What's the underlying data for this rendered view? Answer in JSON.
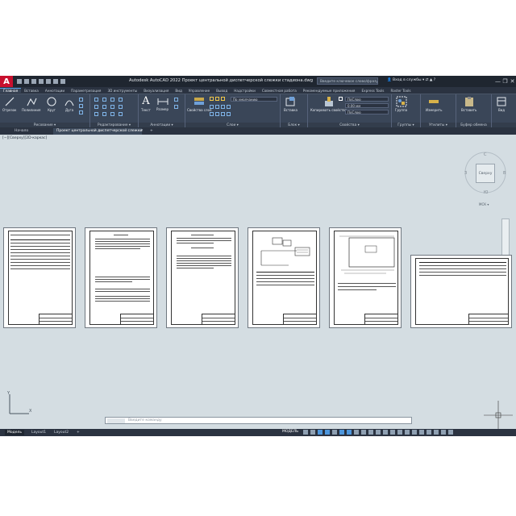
{
  "app": {
    "logo": "A",
    "title": "Autodesk AutoCAD 2022   Проект центральной диспетчерской слежки стадиона.dwg",
    "search_placeholder": "Введите ключевое слово/фразу",
    "login": "Вход в службы",
    "window_buttons": [
      "—",
      "❐",
      "✕"
    ]
  },
  "ribbon_tabs": [
    "Главная",
    "Вставка",
    "Аннотации",
    "Параметризация",
    "3D инструменты",
    "Визуализация",
    "Вид",
    "Управление",
    "Вывод",
    "Надстройки",
    "Совместная работа",
    "Рекомендуемые приложения",
    "Express Tools",
    "Raster Tools"
  ],
  "ribbon": {
    "panels": [
      {
        "label": "Рисование ▾",
        "tools": [
          "Отрезок",
          "Полилиния",
          "Круг",
          "Дуга"
        ]
      },
      {
        "label": "Редактирование ▾",
        "tools": []
      },
      {
        "label": "Аннотации ▾",
        "tools": [
          "Текст",
          "Размер"
        ]
      },
      {
        "label": "Слои ▾",
        "tools": [
          "Свойства слоя"
        ],
        "layer_value": "По умолчанию"
      },
      {
        "label": "Блок ▾",
        "tools": [
          "Вставка"
        ]
      },
      {
        "label": "Свойства ▾",
        "tools": [
          "Копировать свойства"
        ],
        "props": [
          "ПоСлою",
          "0.00 мм",
          "ПоСлою"
        ]
      },
      {
        "label": "Группы ▾",
        "tools": [
          "Группа"
        ]
      },
      {
        "label": "Утилиты ▾",
        "tools": [
          "Измерить"
        ]
      },
      {
        "label": "Буфер обмена",
        "tools": [
          "Вставить"
        ]
      },
      {
        "label": "",
        "tools": [
          "Вид"
        ]
      }
    ]
  },
  "file_tabs": {
    "start": "Начало",
    "active": "Проект центральной диспетчерской слежки стадиона*",
    "close": "✕",
    "new": "+"
  },
  "viewport": {
    "label": "[−][Сверху][2D-каркас]",
    "viewcube": "Сверху",
    "wcs": "МСК ▾",
    "compass": [
      "С",
      "Ю",
      "З",
      "В"
    ]
  },
  "command_line": {
    "placeholder": "Введите команду"
  },
  "status": {
    "tabs": [
      "Модель",
      "Layout1",
      "Layout2"
    ],
    "add": "+",
    "model_toggle": "МОДЕЛЬ"
  }
}
